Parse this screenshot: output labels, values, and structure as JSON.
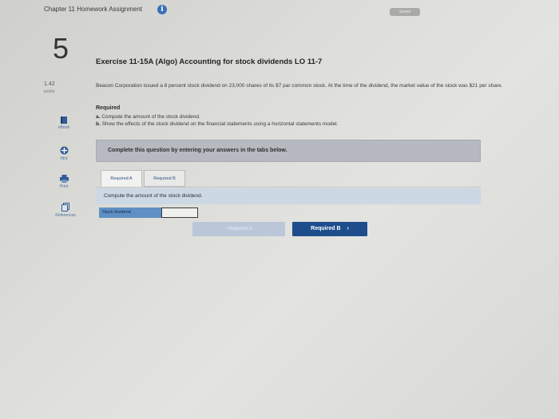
{
  "header": {
    "assignment_title": "Chapter 11 Homework Assignment",
    "info_icon": "info-icon",
    "saved_label": "Saved"
  },
  "question": {
    "number": "5",
    "points_value": "1.42",
    "points_label": "points"
  },
  "sidebar_tools": [
    {
      "label": "eBook",
      "icon": "book-icon"
    },
    {
      "label": "Hint",
      "icon": "hint-icon"
    },
    {
      "label": "Print",
      "icon": "printer-icon"
    },
    {
      "label": "References",
      "icon": "references-icon"
    }
  ],
  "exercise": {
    "title": "Exercise 11-15A (Algo) Accounting for stock dividends LO 11-7",
    "problem_text": "Beacon Corporation issued a 8 percent stock dividend on 23,000 shares of its $7 par common stock. At the time of the dividend, the market value of the stock was $21 per share.",
    "required_heading": "Required",
    "required_a_marker": "a.",
    "required_a_text": "Compute the amount of the stock dividend.",
    "required_b_marker": "b.",
    "required_b_text": "Show the effects of the stock dividend on the financial statements using a horizontal statements model."
  },
  "instructions": "Complete this question by entering your answers in the tabs below.",
  "tabs": [
    {
      "label": "Required A",
      "active": true
    },
    {
      "label": "Required B",
      "active": false
    }
  ],
  "compute_prompt": "Compute the amount of the stock dividend.",
  "answer": {
    "label": "Stock dividend",
    "value": ""
  },
  "navigation": {
    "prev_label": "Required A",
    "next_label": "Required B"
  },
  "colors": {
    "primary": "#1e4d8c",
    "tab_text": "#2b4f86",
    "panel_gray": "#b6b9bf",
    "compute_blue": "#ccd8e4",
    "label_blue": "#5f8fc4"
  }
}
